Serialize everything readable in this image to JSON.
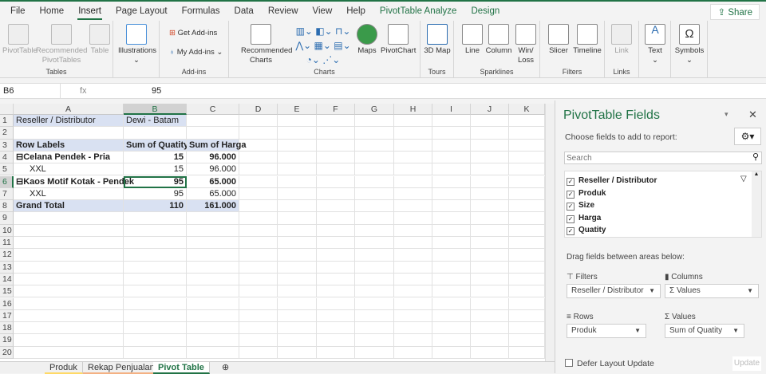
{
  "ribbon": {
    "tabs": [
      "File",
      "Home",
      "Insert",
      "Page Layout",
      "Formulas",
      "Data",
      "Review",
      "View",
      "Help",
      "PivotTable Analyze",
      "Design"
    ],
    "active_tab": "Insert",
    "share": "Share",
    "groups": {
      "tables": "Tables",
      "addins": "Add-ins",
      "charts": "Charts",
      "tours": "Tours",
      "sparklines": "Sparklines",
      "filters": "Filters",
      "links": "Links"
    },
    "buttons": {
      "pivottable": "PivotTable",
      "rec_pivot": "Recommended PivotTables",
      "table": "Table",
      "illustrations": "Illustrations",
      "get_addins": "Get Add-ins",
      "my_addins": "My Add-ins",
      "rec_charts": "Recommended Charts",
      "maps": "Maps",
      "pivotchart": "PivotChart",
      "map3d": "3D Map",
      "line": "Line",
      "column": "Column",
      "winloss": "Win/ Loss",
      "slicer": "Slicer",
      "timeline": "Timeline",
      "link": "Link",
      "text": "Text",
      "symbols": "Symbols"
    }
  },
  "formula": {
    "name_box": "B6",
    "fx": "fx",
    "value": "95"
  },
  "grid": {
    "columns": [
      "A",
      "B",
      "C",
      "D",
      "E",
      "F",
      "G",
      "H",
      "I",
      "J",
      "K"
    ],
    "selected_col": "B",
    "selected_row": 6,
    "rows": [
      [
        "Reseller / Distributor",
        "Dewi - Batam",
        ""
      ],
      [
        "",
        "",
        ""
      ],
      [
        "Row Labels",
        "Sum of Quatity",
        "Sum of Harga"
      ],
      [
        "⊟Celana Pendek - Pria",
        "15",
        "96.000"
      ],
      [
        "XXL",
        "15",
        "96.000"
      ],
      [
        "⊟Kaos Motif Kotak - Pendek",
        "95",
        "65.000"
      ],
      [
        "XXL",
        "95",
        "65.000"
      ],
      [
        "Grand Total",
        "110",
        "161.000"
      ]
    ],
    "row_count": 20
  },
  "sheets": {
    "tabs": [
      "Produk",
      "Rekap Penjualan",
      "Pivot Table"
    ],
    "active": "Pivot Table",
    "tab_colors": [
      "#ffd966",
      "#f4b183",
      "#a9d08e"
    ]
  },
  "panel": {
    "title": "PivotTable Fields",
    "choose": "Choose fields to add to report:",
    "search_placeholder": "Search",
    "fields": [
      {
        "name": "Reseller / Distributor",
        "checked": true,
        "filtered": true
      },
      {
        "name": "Produk",
        "checked": true
      },
      {
        "name": "Size",
        "checked": true
      },
      {
        "name": "Harga",
        "checked": true
      },
      {
        "name": "Quatity",
        "checked": true
      }
    ],
    "drag": "Drag fields between areas below:",
    "filters_label": "Filters",
    "filters_value": "Reseller / Distributor",
    "columns_label": "Columns",
    "columns_value": "Σ Values",
    "rows_label": "Rows",
    "rows_value": "Produk",
    "values_label": "Values",
    "values_value": "Sum of Quatity",
    "defer": "Defer Layout Update",
    "update": "Update"
  },
  "colors": {
    "accent": "#217346",
    "pivot_header": "#d9e1f2"
  }
}
